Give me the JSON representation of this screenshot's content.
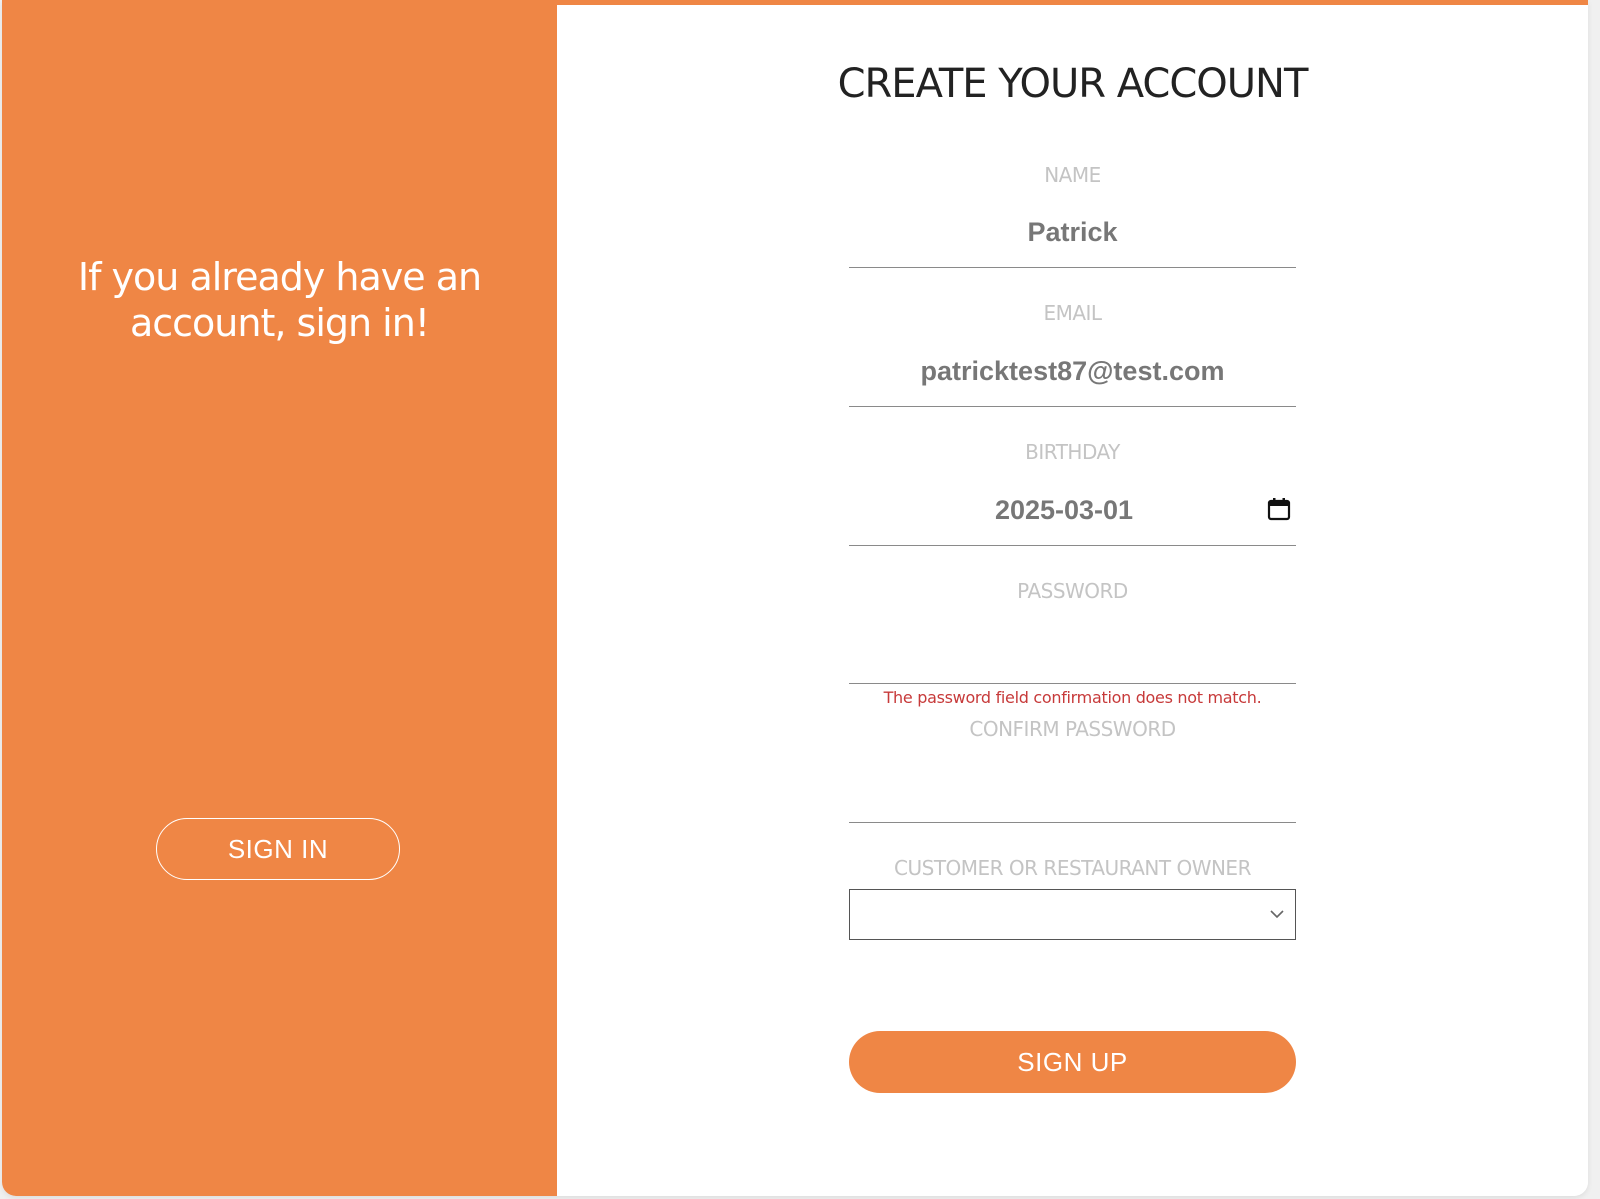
{
  "colors": {
    "accent": "#ef8645",
    "error": "#c73a3a",
    "label": "#c4c4c4",
    "input_text": "#777777"
  },
  "left_panel": {
    "heading": "If you already have an account, sign in!",
    "signin_label": "SIGN IN"
  },
  "form": {
    "title": "CREATE YOUR ACCOUNT",
    "name": {
      "label": "NAME",
      "value": "Patrick"
    },
    "email": {
      "label": "EMAIL",
      "value": "patricktest87@test.com"
    },
    "birthday": {
      "label": "BIRTHDAY",
      "value": "2025-03-01",
      "icon": "calendar-icon"
    },
    "password": {
      "label": "PASSWORD",
      "value": ""
    },
    "password_error": "The password field confirmation does not match.",
    "confirm_password": {
      "label": "CONFIRM PASSWORD",
      "value": ""
    },
    "role": {
      "label": "CUSTOMER OR RESTAURANT OWNER",
      "selected": "",
      "icon": "chevron-down-icon"
    },
    "signup_label": "SIGN UP"
  }
}
